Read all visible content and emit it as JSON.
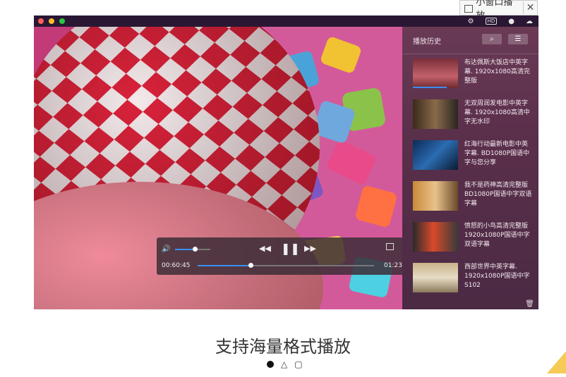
{
  "pip_button": {
    "label": "小窗口播放",
    "close": "✕"
  },
  "window": {
    "title_icons": [
      "gear-icon",
      "hd-icon",
      "globe-icon",
      "cloud-icon"
    ]
  },
  "sidebar": {
    "title": "播放历史",
    "items": [
      {
        "text": "布达佩斯大饭店中英字幕. 1920x1080高清完整版",
        "progress": 0.75
      },
      {
        "text": "无双周润发电影中英字幕. 1920x1080高清中字无水印"
      },
      {
        "text": "红海行动最新电影中英字幕. BD1080P国语中字与您分享"
      },
      {
        "text": "我不是药神高清完整版 BD1080P国语中字双语字幕"
      },
      {
        "text": "愤怒的小鸟高清完整版1920x1080P国语中字双语字幕"
      },
      {
        "text": "西部世界中英字幕. 1920x1080P国语中字S102"
      }
    ]
  },
  "player": {
    "current_time": "00:60:45",
    "end_time": "01:23",
    "volume": 0.55,
    "progress": 0.3
  },
  "caption": "支持海量格式播放",
  "pagination": {
    "active": 0,
    "count": 3
  }
}
